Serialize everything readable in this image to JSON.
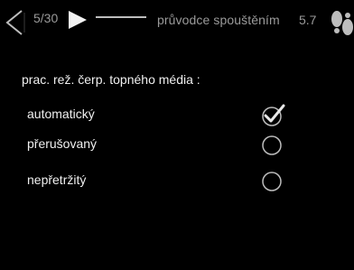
{
  "header": {
    "page_counter": "5/30",
    "guide_title": "průvodce spouštěním",
    "guide_number": "5.7"
  },
  "main": {
    "parameter_label": "prac. rež. čerp. topného média :",
    "options": [
      {
        "label": "automatický",
        "selected": true
      },
      {
        "label": "přerušovaný",
        "selected": false
      },
      {
        "label": "nepřetržitý",
        "selected": false
      }
    ]
  },
  "icons": {
    "prev": "chevron-left-icon",
    "next": "play-right-icon",
    "guide": "footprints-icon",
    "selected": "checkmark-icon"
  }
}
